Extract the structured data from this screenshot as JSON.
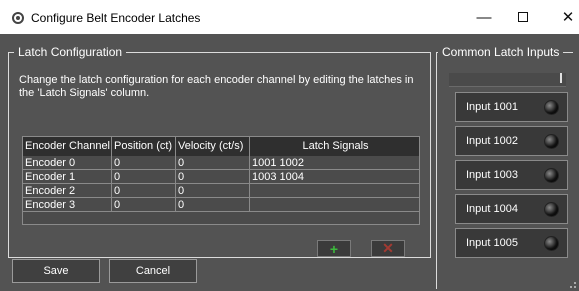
{
  "window": {
    "title": "Configure Belt Encoder Latches",
    "minimize_symbol": "—",
    "close_symbol": "✕"
  },
  "latch_configuration": {
    "group_title": "Latch Configuration",
    "description": "Change the latch configuration for each encoder channel by editing the latches in the 'Latch Signals' column.",
    "columns": [
      "Encoder Channel",
      "Position (ct)",
      "Velocity (ct/s)",
      "Latch Signals"
    ],
    "rows": [
      {
        "channel": "Encoder 0",
        "position": "0",
        "velocity": "0",
        "latch_signals": "1001 1002"
      },
      {
        "channel": "Encoder 1",
        "position": "0",
        "velocity": "0",
        "latch_signals": "1003 1004"
      },
      {
        "channel": "Encoder 2",
        "position": "0",
        "velocity": "0",
        "latch_signals": ""
      },
      {
        "channel": "Encoder 3",
        "position": "0",
        "velocity": "0",
        "latch_signals": ""
      }
    ],
    "add_icon": "plus-icon",
    "remove_icon": "x-icon",
    "add_glyph": "+",
    "remove_glyph": "✕"
  },
  "common_latch_inputs": {
    "group_title": "Common Latch Inputs",
    "inputs": [
      {
        "label": "Input 1001",
        "state": "off"
      },
      {
        "label": "Input 1002",
        "state": "off"
      },
      {
        "label": "Input 1003",
        "state": "off"
      },
      {
        "label": "Input 1004",
        "state": "off"
      },
      {
        "label": "Input 1005",
        "state": "off"
      }
    ]
  },
  "buttons": {
    "save": "Save",
    "cancel": "Cancel"
  },
  "colors": {
    "background": "#535353",
    "add_green": "#3dbb3d",
    "remove_red": "#a33a32"
  }
}
